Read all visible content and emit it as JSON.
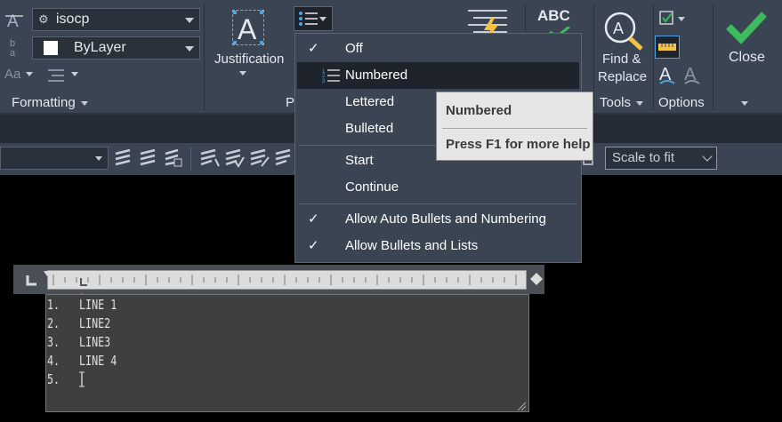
{
  "ribbon": {
    "text_style": "isocp",
    "color": "ByLayer",
    "formatting_label": "Formatting",
    "justification_label": "Justification",
    "paragraph_label": "Pa",
    "find_replace_label_1": "Find &",
    "find_replace_label_2": "Replace",
    "tools_label": "Tools",
    "options_label": "Options",
    "close_label": "Close",
    "spell_label": "ABC",
    "font_size_glyph": "Aa"
  },
  "bullets_menu": {
    "items": [
      {
        "label": "Off",
        "checked": true
      },
      {
        "label": "Numbered",
        "checked": false,
        "highlighted": true
      },
      {
        "label": "Lettered",
        "checked": false
      },
      {
        "label": "Bulleted",
        "checked": false
      },
      {
        "label": "Start",
        "checked": false
      },
      {
        "label": "Continue",
        "checked": false
      },
      {
        "label": "Allow Auto Bullets and Numbering",
        "checked": true
      },
      {
        "label": "Allow Bullets and Lists",
        "checked": true
      }
    ],
    "check_glyph": "✓"
  },
  "tooltip": {
    "title": "Numbered",
    "help": "Press F1 for more help"
  },
  "toolbar": {
    "scale_value": "Scale to fit"
  },
  "editor": {
    "lines": [
      {
        "num": "1.",
        "text": "LINE 1"
      },
      {
        "num": "2.",
        "text": "LINE2"
      },
      {
        "num": "3.",
        "text": "LINE3"
      },
      {
        "num": "4.",
        "text": "LINE 4"
      },
      {
        "num": "5.",
        "text": ""
      }
    ]
  },
  "colors": {
    "ribbon_bg": "#3b4453",
    "accent_green": "#3dbb5e",
    "accent_blue": "#4ea3e0",
    "highlight_yellow": "#f5c343"
  }
}
